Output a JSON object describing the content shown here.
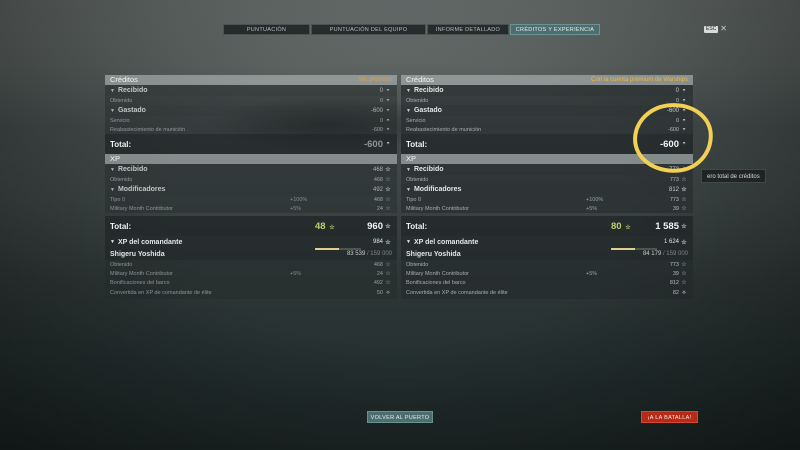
{
  "tabs": [
    {
      "label": "PUNTUACIÓN",
      "active": false
    },
    {
      "label": "PUNTUACIÓN DEL EQUIPO",
      "active": false
    },
    {
      "label": "INFORME DETALLADO",
      "active": false
    },
    {
      "label": "CRÉDITOS Y EXPERIENCIA",
      "active": true
    }
  ],
  "close_hint_key": "ESC",
  "close_glyph": "✕",
  "icons": {
    "credit": "credit-icon",
    "xp": "star-icon",
    "commander_xp": "commander-star-icon",
    "elite_xp": "elite-xp-icon"
  },
  "colors": {
    "accent_tab": "#4d6e70",
    "premium_note": "#f0b83a",
    "green_value": "#b7d36b",
    "battle_button": "#b52b17",
    "highlight": "#f2cf55"
  },
  "left": {
    "credits": {
      "title": "Créditos",
      "note": "Sin premium",
      "received_label": "Recibido",
      "received_value": "0",
      "obtained_label": "Obtenido",
      "obtained_value": "0",
      "spent_label": "Gastado",
      "spent_value": "-600",
      "service_label": "Servicio",
      "service_value": "0",
      "ammo_label": "Reabastecimiento de munición",
      "ammo_value": "-600",
      "total_label": "Total:",
      "total_value": "-600"
    },
    "xp": {
      "title": "XP",
      "received_label": "Recibido",
      "received_value": "468",
      "obtained_label": "Obtenido",
      "obtained_value": "468",
      "modifiers_label": "Modificadores",
      "modifiers_value": "492",
      "type0_label": "Tipo 0",
      "type0_pct": "+100%",
      "type0_value": "468",
      "mmc_label": "Military Month Contributor",
      "mmc_pct": "+5%",
      "mmc_value": "24",
      "total_label": "Total:",
      "total_green": "48",
      "total_value": "960"
    },
    "commander": {
      "label": "XP del comandante",
      "value": "984",
      "name": "Shigeru Yoshida",
      "xp_current": "83 539",
      "xp_max": "/ 159 000",
      "progress": 0.525,
      "obtained_label": "Obtenido",
      "obtained_value": "468",
      "mmc_label": "Military Month Contributor",
      "mmc_pct": "+5%",
      "mmc_value": "24",
      "ship_bonus_label": "Bonificaciones del barco",
      "ship_bonus_value": "492",
      "elite_label": "Convertida en XP de comandante de élite",
      "elite_value": "50"
    }
  },
  "right": {
    "credits": {
      "title": "Créditos",
      "note": "Con la cuenta premium de Warships",
      "received_label": "Recibido",
      "received_value": "0",
      "obtained_label": "Obtenido",
      "obtained_value": "0",
      "spent_label": "Gastado",
      "spent_value": "-600",
      "service_label": "Servicio",
      "service_value": "0",
      "ammo_label": "Reabastecimiento de munición",
      "ammo_value": "-600",
      "total_label": "Total:",
      "total_value": "-600"
    },
    "xp": {
      "title": "XP",
      "received_label": "Recibido",
      "received_value": "773",
      "obtained_label": "Obtenido",
      "obtained_value": "773",
      "modifiers_label": "Modificadores",
      "modifiers_value": "812",
      "type0_label": "Tipo 0",
      "type0_pct": "+100%",
      "type0_value": "773",
      "mmc_label": "Military Month Contributor",
      "mmc_pct": "+5%",
      "mmc_value": "39",
      "total_label": "Total:",
      "total_green": "80",
      "total_value": "1 585"
    },
    "commander": {
      "label": "XP del comandante",
      "value": "1 624",
      "name": "Shigeru Yoshida",
      "xp_current": "84 179",
      "xp_max": "/ 159 000",
      "progress": 0.529,
      "obtained_label": "Obtenido",
      "obtained_value": "773",
      "mmc_label": "Military Month Contributor",
      "mmc_pct": "+5%",
      "mmc_value": "39",
      "ship_bonus_label": "Bonificaciones del barco",
      "ship_bonus_value": "812",
      "elite_label": "Convertida en XP de comandante de élite",
      "elite_value": "82"
    }
  },
  "tooltip": "ero total de créditos",
  "buttons": {
    "port": "VOLVER AL PUERTO",
    "battle": "¡A LA BATALLA!"
  }
}
